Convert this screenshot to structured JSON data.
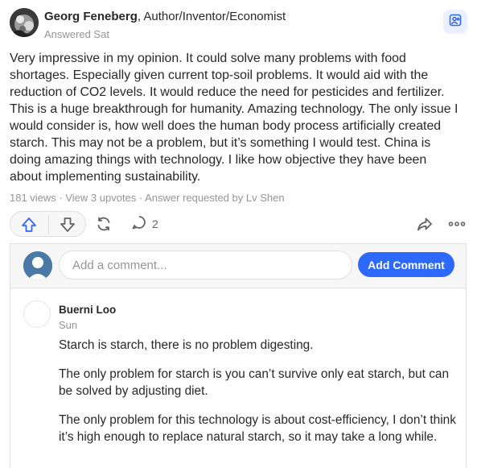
{
  "answer": {
    "author_name": "Georg Feneberg",
    "credential": ", Author/Inventor/Economist",
    "answered": "Answered Sat",
    "text": "Very impressive in my opinion. It could solve many problems with food shortages. Especially given current top-soil problems. It would aid with the reduction of CO2 levels. It would reduce the need for pesticides and fertilizer. This is a huge breakthrough for humanity. Amazing technology. The only issue I would consider is, how well does the human body process artificially created starch. This may not be a problem, but it’s something I would test. China is doing amazing things with technology. I like how objective they have been about implementing sustainability.",
    "meta": "181 views · View 3 upvotes · Answer requested by Lv Shen"
  },
  "actions": {
    "comment_count": "2"
  },
  "comments": {
    "placeholder": "Add a comment...",
    "add_label": "Add Comment",
    "items": [
      {
        "name": "Buerni Loo",
        "date": "Sun",
        "paragraphs": [
          "Starch is starch, there is no problem digesting.",
          "The only problem for starch is you can’t survive only eat starch, but can be solved by adjusting diet.",
          "The only problem for this technology is about cost-efficiency, I don’t think it’s high enough to replace natural starch, so it may take a long while."
        ]
      }
    ]
  },
  "colors": {
    "accent": "#2e69ff",
    "muted": "#939598",
    "text": "#282829"
  },
  "icons": [
    "follow-icon",
    "upvote-icon",
    "downvote-icon",
    "share-icon",
    "comment-icon",
    "reshare-icon",
    "more-icon"
  ]
}
